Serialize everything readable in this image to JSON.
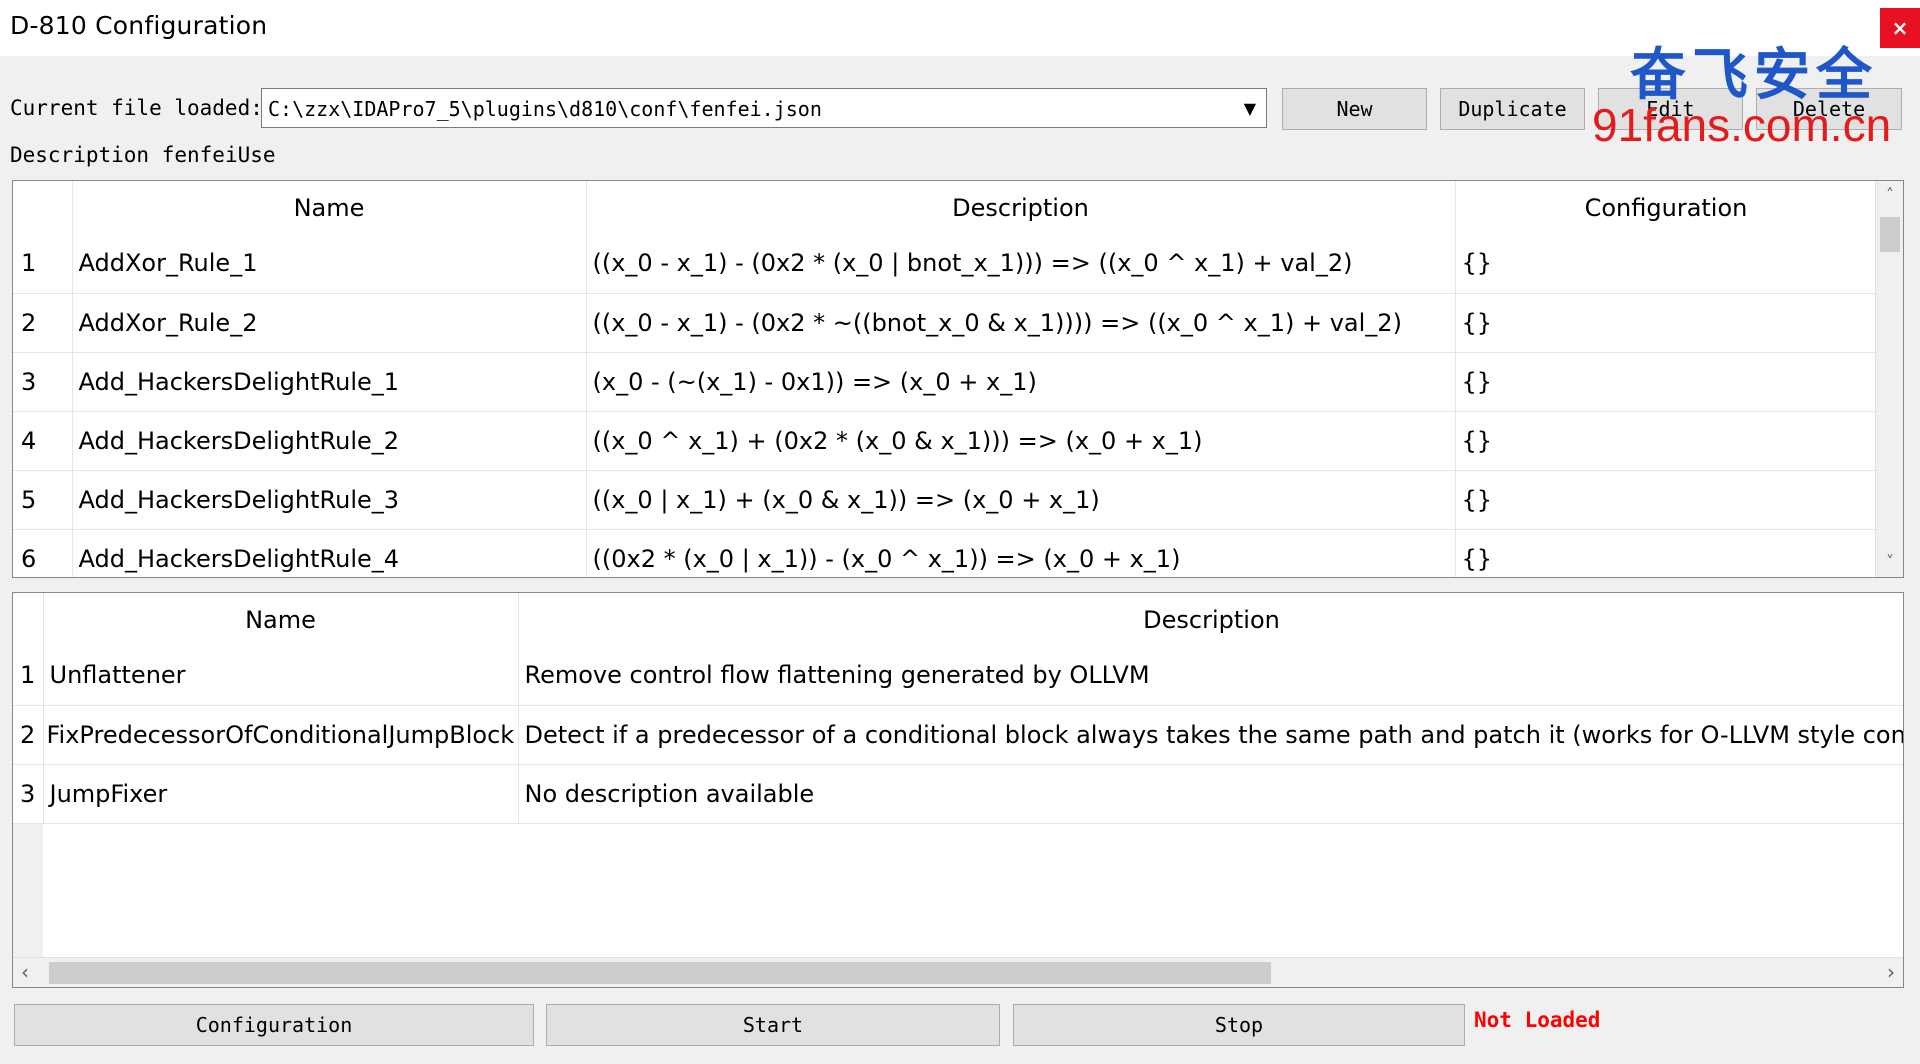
{
  "window": {
    "title": "D-810 Configuration",
    "close_glyph": "×"
  },
  "file": {
    "label": "Current file loaded:",
    "path": "C:\\zzx\\IDAPro7_5\\plugins\\d810\\conf\\fenfei.json"
  },
  "toolbar": {
    "new_label": "New",
    "duplicate_label": "Duplicate",
    "edit_label": "Edit",
    "delete_label": "Delete"
  },
  "description": {
    "label": "Description",
    "value": "fenfeiUse"
  },
  "rules_table": {
    "columns": [
      "Name",
      "Description",
      "Configuration"
    ],
    "rows": [
      {
        "num": "1",
        "name": "AddXor_Rule_1",
        "description": "((x_0 - x_1) - (0x2 * (x_0 | bnot_x_1))) => ((x_0 ^ x_1) + val_2)",
        "config": "{}"
      },
      {
        "num": "2",
        "name": "AddXor_Rule_2",
        "description": "((x_0 - x_1) - (0x2 * ~((bnot_x_0 & x_1)))) => ((x_0 ^ x_1) + val_2)",
        "config": "{}"
      },
      {
        "num": "3",
        "name": "Add_HackersDelightRule_1",
        "description": "(x_0 - (~(x_1) - 0x1)) => (x_0 + x_1)",
        "config": "{}"
      },
      {
        "num": "4",
        "name": "Add_HackersDelightRule_2",
        "description": "((x_0 ^ x_1) + (0x2 * (x_0 & x_1))) => (x_0 + x_1)",
        "config": "{}"
      },
      {
        "num": "5",
        "name": "Add_HackersDelightRule_3",
        "description": "((x_0 | x_1) + (x_0 & x_1)) => (x_0 + x_1)",
        "config": "{}"
      },
      {
        "num": "6",
        "name": "Add_HackersDelightRule_4",
        "description": "((0x2 * (x_0 | x_1)) - (x_0 ^ x_1)) => (x_0 + x_1)",
        "config": "{}"
      }
    ]
  },
  "block_table": {
    "columns": [
      "Name",
      "Description"
    ],
    "rows": [
      {
        "num": "1",
        "name": "Unflattener",
        "description": "Remove control flow flattening generated by OLLVM"
      },
      {
        "num": "2",
        "name": "FixPredecessorOfConditionalJumpBlock",
        "description": "Detect if a predecessor of a conditional block always takes the same path and patch it (works for O-LLVM style contro"
      },
      {
        "num": "3",
        "name": "JumpFixer",
        "description": "No description available"
      }
    ]
  },
  "bottom": {
    "configuration_label": "Configuration",
    "start_label": "Start",
    "stop_label": "Stop",
    "status": "Not Loaded"
  },
  "watermark": {
    "cn": "奋飞安全",
    "en": "91fans.com.cn"
  },
  "colors": {
    "status": "#ff0000",
    "close": "#e81123",
    "watermark_cn": "#1f56c8",
    "watermark_en": "#e51b1b"
  }
}
